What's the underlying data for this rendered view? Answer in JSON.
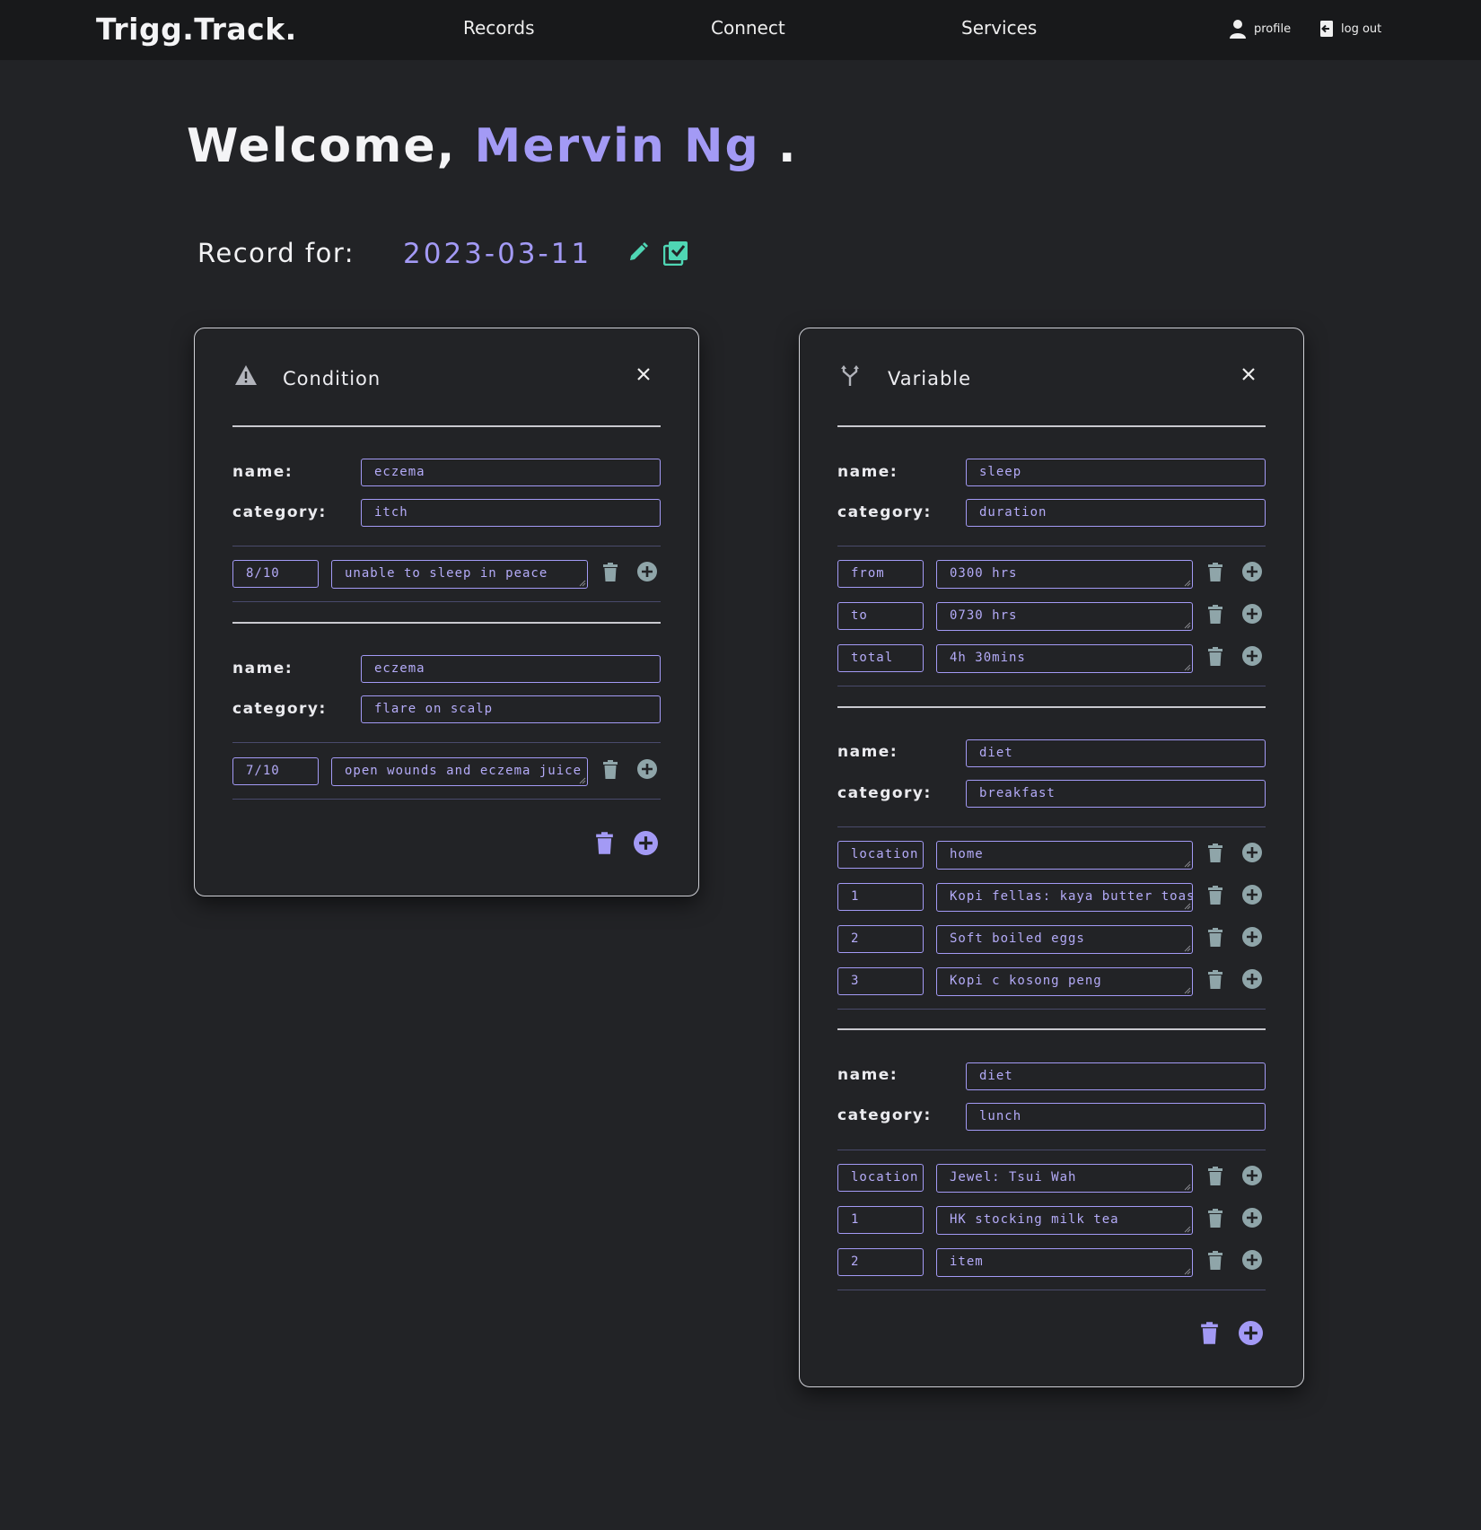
{
  "nav": {
    "brand": "Trigg.Track.",
    "links": [
      "Records",
      "Connect",
      "Services"
    ],
    "profile_label": "profile",
    "logout_label": "log out"
  },
  "welcome": {
    "greeting": "Welcome,",
    "user_name": "Mervin Ng",
    "punct": "."
  },
  "record": {
    "label": "Record for:",
    "date": "2023-03-11"
  },
  "colors": {
    "accent": "#a39af5",
    "teal": "#4fd6b4",
    "background": "#222326",
    "nav": "#18191b"
  },
  "condition_card": {
    "title": "Condition",
    "icon": "warning-icon",
    "entries": [
      {
        "name_label": "name:",
        "name": "eczema",
        "category_label": "category:",
        "category": "itch",
        "rows": [
          {
            "key": "8/10",
            "value": "unable to sleep in peace"
          }
        ]
      },
      {
        "name_label": "name:",
        "name": "eczema",
        "category_label": "category:",
        "category": "flare on scalp",
        "rows": [
          {
            "key": "7/10",
            "value": "open wounds and eczema juice"
          }
        ]
      }
    ]
  },
  "variable_card": {
    "title": "Variable",
    "icon": "fork-icon",
    "entries": [
      {
        "name_label": "name:",
        "name": "sleep",
        "category_label": "category:",
        "category": "duration",
        "rows": [
          {
            "key": "from",
            "value": "0300 hrs"
          },
          {
            "key": "to",
            "value": "0730 hrs"
          },
          {
            "key": "total",
            "value": "4h 30mins"
          }
        ]
      },
      {
        "name_label": "name:",
        "name": "diet",
        "category_label": "category:",
        "category": "breakfast",
        "rows": [
          {
            "key": "location",
            "value": "home"
          },
          {
            "key": "1",
            "value": "Kopi fellas: kaya butter toast"
          },
          {
            "key": "2",
            "value": "Soft boiled eggs"
          },
          {
            "key": "3",
            "value": "Kopi c kosong peng"
          }
        ]
      },
      {
        "name_label": "name:",
        "name": "diet",
        "category_label": "category:",
        "category": "lunch",
        "rows": [
          {
            "key": "location",
            "value": "Jewel: Tsui Wah"
          },
          {
            "key": "1",
            "value": "HK stocking milk tea"
          },
          {
            "key": "2",
            "value": "item"
          }
        ]
      }
    ]
  }
}
